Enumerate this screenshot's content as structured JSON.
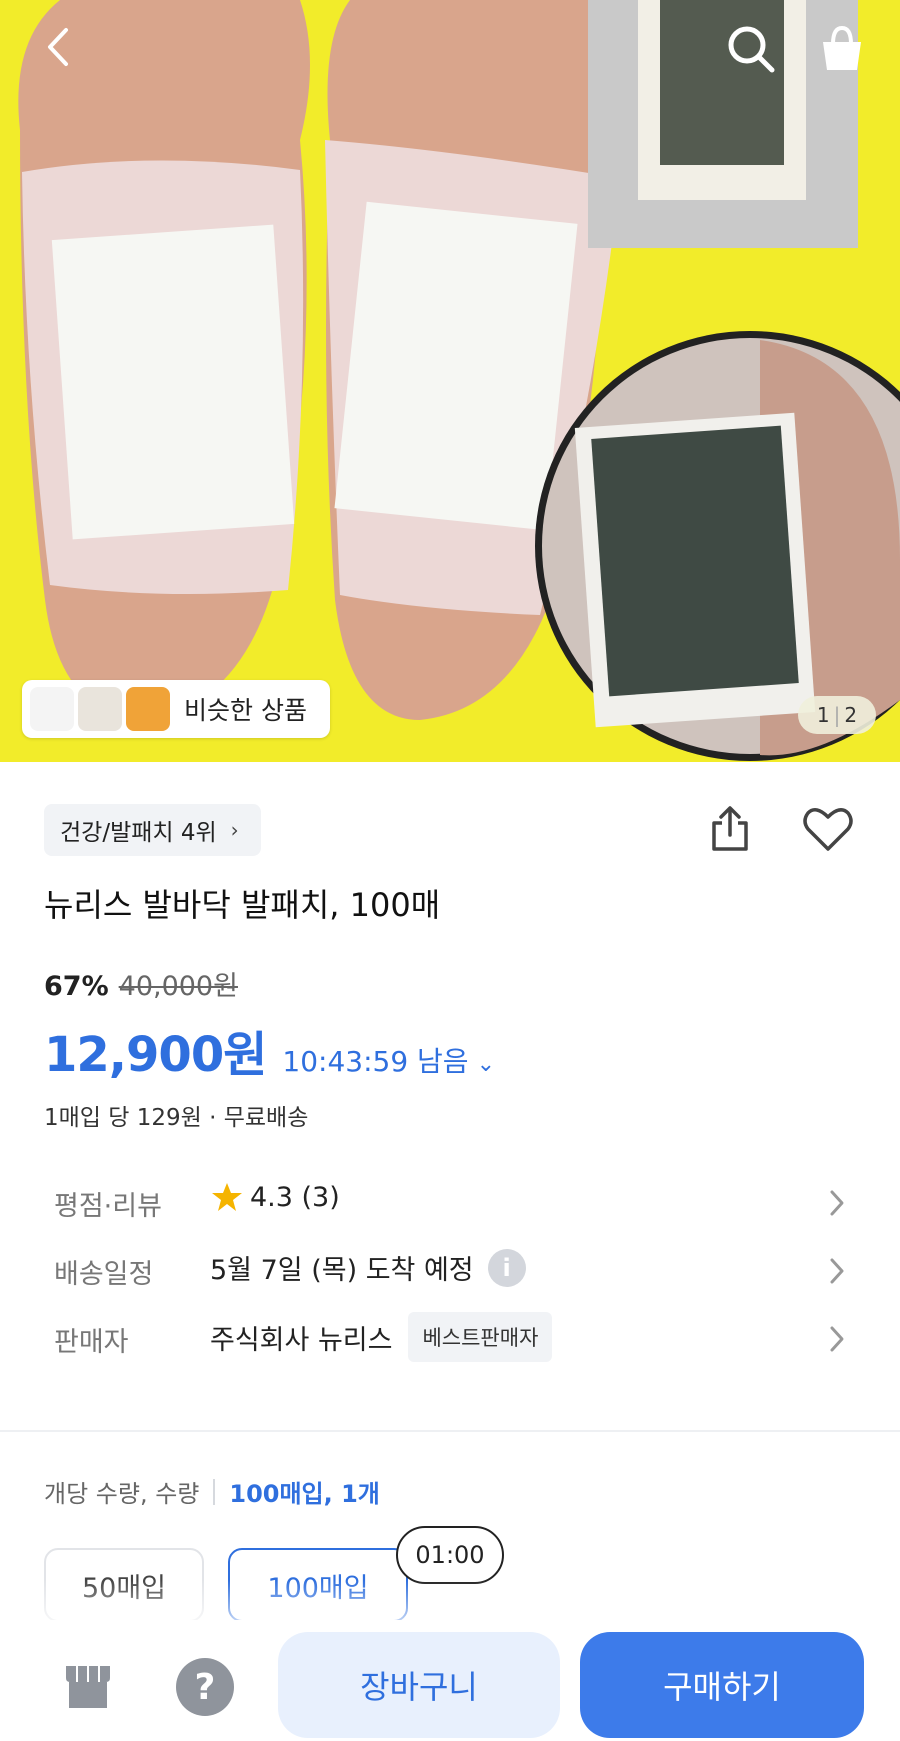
{
  "hero": {
    "similar_label": "비슷한 상품",
    "counter_current": "1",
    "counter_total": "2"
  },
  "product": {
    "rank_chip": "건강/발패치 4위",
    "title": "뉴리스 발바닥 발패치, 100매",
    "discount_pct": "67%",
    "original_price": "40,000원",
    "price": "12,900원",
    "timer": "10:43:59 남음",
    "unit_info": "1매입 당 129원 · 무료배송"
  },
  "meta": {
    "rating_label": "평점·리뷰",
    "rating_value": "4.3 (3)",
    "delivery_label": "배송일정",
    "delivery_value": "5월 7일 (목) 도착 예정",
    "seller_label": "판매자",
    "seller_value": "주식회사 뉴리스",
    "seller_badge": "베스트판매자"
  },
  "options": {
    "label": "개당 수량, 수량",
    "selected": "100매입, 1개",
    "choices": [
      "50매입",
      "100매입"
    ],
    "time_bubble": "01:00"
  },
  "bottom": {
    "help_glyph": "?",
    "cart_label": "장바구니",
    "buy_label": "구매하기"
  },
  "colors": {
    "accent": "#2f6fde",
    "buy_button": "#3d7bea",
    "cart_button_bg": "#e8f0fd",
    "hero_background": "#f2ec2a",
    "star": "#f5b400"
  },
  "icons": [
    "back-icon",
    "search-icon",
    "shopping-bag-icon",
    "share-icon",
    "heart-icon",
    "star-icon",
    "info-icon",
    "chevron-right-icon",
    "chevron-down-icon",
    "store-icon",
    "help-icon"
  ]
}
